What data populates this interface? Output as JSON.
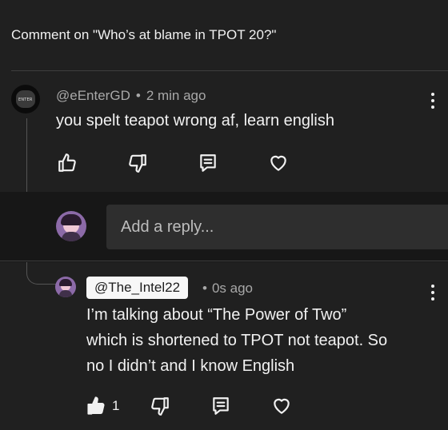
{
  "header": {
    "title": "Comment on \"Who’s at blame in TPOT 20?\""
  },
  "comment": {
    "author": "@eEnterGD",
    "time": "2 min ago",
    "text": "you spelt teapot wrong af, learn english",
    "avatar_text": "ENTER"
  },
  "reply_box": {
    "placeholder": "Add a reply..."
  },
  "reply": {
    "author": "@The_Intel22",
    "time": "0s ago",
    "text_lines": [
      "I’m talking about “The Power of Two”",
      "which is shortened to TPOT not teapot. So",
      "no I didn’t and I know English"
    ],
    "like_count": "1"
  },
  "icons": {
    "like": "thumbs-up-icon",
    "dislike": "thumbs-down-icon",
    "reply": "comment-icon",
    "heart": "heart-icon",
    "menu": "kebab-menu-icon"
  },
  "colors": {
    "background": "#202020",
    "panel": "#171717",
    "input": "#2e2e2e",
    "text": "#f1f1f1",
    "muted": "#a8a8a8"
  }
}
